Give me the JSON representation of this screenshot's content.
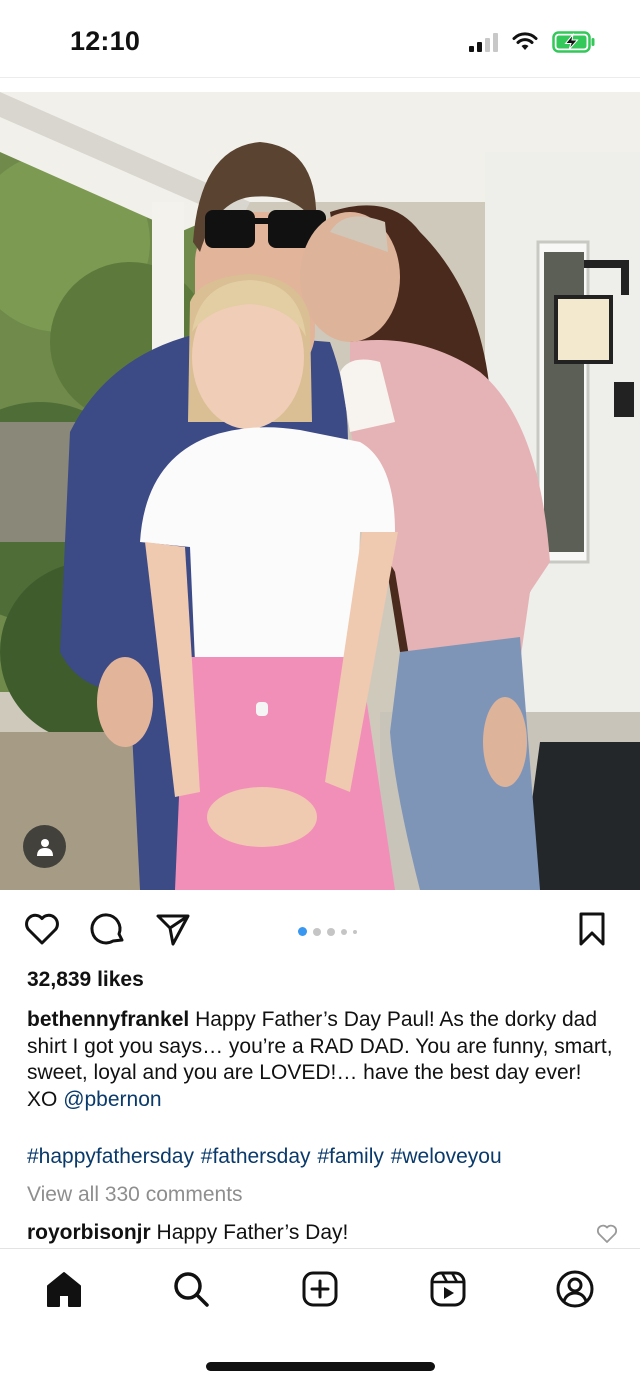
{
  "status_bar": {
    "time": "12:10",
    "icons": [
      "cellular-signal-icon",
      "wifi-icon",
      "battery-charging-icon"
    ],
    "battery_color": "#34c759"
  },
  "post": {
    "image": {
      "description_icon": "tag-people-icon",
      "carousel_dots": 5,
      "active_dot": 0,
      "accent": "#3897f0"
    },
    "actions": {
      "like_icon": "heart-icon",
      "comment_icon": "comment-icon",
      "share_icon": "send-icon",
      "save_icon": "bookmark-icon"
    },
    "likes": "32,839 likes",
    "caption": {
      "username": "bethennyfrankel",
      "text": "Happy Father’s Day Paul! As the dorky dad shirt I got you says… you’re a RAD DAD. You are funny, smart, sweet, loyal and you are LOVED!… have the best day ever! XO",
      "mention": "@pbernon"
    },
    "hashtags": "#happyfathersday #fathersday #family #weloveyou",
    "view_comments": "View all 330 comments",
    "top_comment": {
      "username": "royorbisonjr",
      "text": "Happy Father’s Day!"
    }
  },
  "tabbar": {
    "tabs": [
      "home-icon",
      "search-icon",
      "create-icon",
      "reels-icon",
      "profile-icon"
    ]
  }
}
